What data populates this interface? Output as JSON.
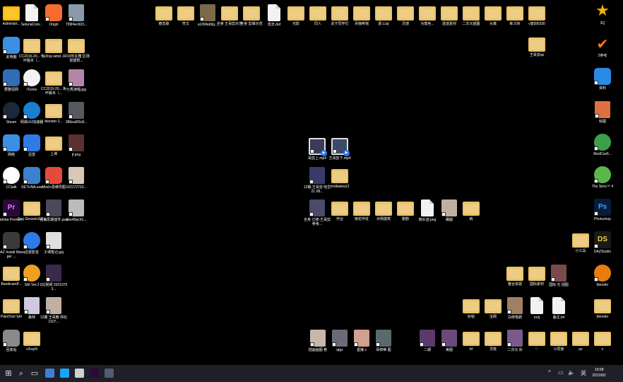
{
  "desktop": {
    "colors": {
      "background": "#000000",
      "taskbar": "#1f1f27",
      "label": "#ffffff",
      "folder": "#e9c26a"
    },
    "icons": {
      "left": [
        {
          "label": "Administr...",
          "kind": "folder-user",
          "color": "#ffb900"
        },
        {
          "label": "SetunaCom...",
          "kind": "doc",
          "color": "#f2f2f2"
        },
        {
          "label": "Origin",
          "kind": "app",
          "color": "#f56c2d"
        },
        {
          "label": "709f4ec603...",
          "kind": "thumb",
          "color": "#8a9aaa"
        },
        {
          "label": "此电脑",
          "kind": "app",
          "color": "#3b90e6"
        },
        {
          "label": "CC2015-20... 免坏版本（...",
          "kind": "folder",
          "color": "#e9c26a"
        },
        {
          "label": "v2ray-wind...",
          "kind": "folder",
          "color": "#e9c26a"
        },
        {
          "label": "6019年在雅 区场景建筑...",
          "kind": "folder",
          "color": "#e9c26a"
        },
        {
          "label": "要雅招网",
          "kind": "app",
          "color": "#2f6db5"
        },
        {
          "label": "iTunes",
          "kind": "round",
          "color": "#f2f2f2"
        },
        {
          "label": "CC2015-20... 免坏版本（...",
          "kind": "folder",
          "color": "#e9c26a"
        },
        {
          "label": "七秀演唱.jpg",
          "kind": "thumb",
          "color": "#b585a8"
        },
        {
          "label": "Steam",
          "kind": "round",
          "color": "#1b2838"
        },
        {
          "label": "网易UU加速器",
          "kind": "round",
          "color": "#1a7fd1"
        },
        {
          "label": "blender-2...",
          "kind": "folder",
          "color": "#e9c26a"
        },
        {
          "label": "386ea5f3c8...",
          "kind": "thumb",
          "color": "#555a60"
        },
        {
          "label": "网络",
          "kind": "app",
          "color": "#3b90e6"
        },
        {
          "label": "迅雷",
          "kind": "app",
          "color": "#2e7ae6"
        },
        {
          "label": "上课",
          "kind": "folder",
          "color": "#e9c26a"
        },
        {
          "label": "jf.png",
          "kind": "thumb",
          "color": "#5a3030"
        },
        {
          "label": "CCtalk",
          "kind": "round",
          "color": "#ffffff"
        },
        {
          "label": "SETUNA.exe",
          "kind": "app",
          "color": "#3c80d0"
        },
        {
          "label": "Mind+思维导图",
          "kind": "app",
          "color": "#e64a3c"
        },
        {
          "label": "162172723...",
          "kind": "thumb",
          "color": "#d8c8b8"
        },
        {
          "label": "Adobe Premie...",
          "kind": "pr",
          "color": "#2a0a3a"
        },
        {
          "label": "Daz Genesis3.2...",
          "kind": "folder",
          "color": "#e9c26a"
        },
        {
          "label": "我偏思期插件.psd",
          "kind": "thumb",
          "color": "#4a4a5a"
        },
        {
          "label": "abe49ac41...",
          "kind": "thumb",
          "color": "#bbbbbb"
        },
        {
          "label": "DAZ Install Manager ...",
          "kind": "app",
          "color": "#3a3a3a"
        },
        {
          "label": "迅雷影音",
          "kind": "round",
          "color": "#2e7ae6"
        },
        {
          "label": "子课笔记.jpg",
          "kind": "thumb",
          "color": "#e0e0e0"
        },
        {
          "label": "BandicamP...",
          "kind": "folder",
          "color": "#e9c26a"
        },
        {
          "label": "SAI Ver.2",
          "kind": "round",
          "color": "#f0a020"
        },
        {
          "label": "QQ视频 20210703...",
          "kind": "thumb",
          "color": "#3a2a4a"
        },
        {
          "label": "PaintTool SAI",
          "kind": "folder",
          "color": "#e9c26a"
        },
        {
          "label": "森林",
          "kind": "thumb",
          "color": "#d0c8e0"
        },
        {
          "label": "12期 王哥教 师社 2107...",
          "kind": "thumb",
          "color": "#c0b0a0"
        },
        {
          "label": "回收站",
          "kind": "app",
          "color": "#8a8a8a"
        },
        {
          "label": "v2rayN",
          "kind": "folder",
          "color": "#e9c26a"
        }
      ],
      "top": [
        {
          "label": "春恋歌",
          "kind": "folder",
          "color": "#e9c26a"
        },
        {
          "label": "符文",
          "kind": "folder",
          "color": "#e9c26a"
        },
        {
          "label": "a10Wab9g...",
          "kind": "thumb",
          "color": "#7a6a4a"
        },
        {
          "label": "全身 王哥剪示范",
          "kind": "folder",
          "color": "#e9c26a"
        },
        {
          "label": "全身 剪辑示范",
          "kind": "folder",
          "color": "#e9c26a"
        },
        {
          "label": "恐无.duf",
          "kind": "doc",
          "color": "#f2f2f2"
        },
        {
          "label": "光影",
          "kind": "folder",
          "color": "#e9c26a"
        },
        {
          "label": "同人",
          "kind": "folder",
          "color": "#e9c26a"
        },
        {
          "label": "关于同学们",
          "kind": "folder",
          "color": "#e9c26a"
        },
        {
          "label": "吊咖啡馆",
          "kind": "folder",
          "color": "#e9c26a"
        },
        {
          "label": "素三sp",
          "kind": "folder",
          "color": "#e9c26a"
        },
        {
          "label": "灵感",
          "kind": "folder",
          "color": "#e9c26a"
        },
        {
          "label": "为角色...",
          "kind": "folder",
          "color": "#e9c26a"
        },
        {
          "label": "透透素材",
          "kind": "folder",
          "color": "#e9c26a"
        },
        {
          "label": "二次元插图",
          "kind": "folder",
          "color": "#e9c26a"
        },
        {
          "label": "头像",
          "kind": "folder",
          "color": "#e9c26a"
        },
        {
          "label": "练习块",
          "kind": "folder",
          "color": "#e9c26a"
        },
        {
          "label": "v富剑0330",
          "kind": "folder",
          "color": "#e9c26a"
        },
        {
          "label": "王哥剪sp",
          "kind": "folder",
          "color": "#e9c26a"
        }
      ],
      "middle": [
        {
          "label": "哥剪上.mp4",
          "kind": "video",
          "color": "#3a3a5a"
        },
        {
          "label": "王哥剪下.mp4",
          "kind": "video",
          "color": "#3a4a6a"
        },
        {
          "label": "12期-王哥剪 哈生 21 08...",
          "kind": "thumb",
          "color": "#3a3a6a"
        },
        {
          "label": "nndlawha12",
          "kind": "folder",
          "color": "#e9c26a"
        },
        {
          "label": "全身 己修-王哥剪 参考...",
          "kind": "thumb",
          "color": "#4a4a6a"
        },
        {
          "label": "作业",
          "kind": "folder",
          "color": "#e9c26a"
        },
        {
          "label": "雨花作仗",
          "kind": "folder",
          "color": "#e9c26a"
        },
        {
          "label": "示例建筑",
          "kind": "folder",
          "color": "#e9c26a"
        },
        {
          "label": "剧剧",
          "kind": "folder",
          "color": "#e9c26a"
        },
        {
          "label": "御头迹.png",
          "kind": "doc",
          "color": "#f2f2f2"
        },
        {
          "label": "绷腿",
          "kind": "thumb",
          "color": "#c0b0a0"
        },
        {
          "label": "纳",
          "kind": "folder",
          "color": "#e9c26a"
        }
      ],
      "bottom": [
        {
          "label": "插画画图 卷",
          "kind": "thumb",
          "color": "#c8b8a8"
        },
        {
          "label": "qtgz",
          "kind": "thumb",
          "color": "#6a6a7a"
        },
        {
          "label": "墨播 z",
          "kind": "thumb",
          "color": "#d0a090"
        },
        {
          "label": "佰修稀 图",
          "kind": "thumb",
          "color": "#5a6a6a"
        },
        {
          "label": "二期",
          "kind": "thumb",
          "color": "#5a3a6a"
        },
        {
          "label": "美图",
          "kind": "thumb",
          "color": "#6a4a7a"
        },
        {
          "label": "bf",
          "kind": "folder",
          "color": "#e9c26a"
        },
        {
          "label": "灵枝",
          "kind": "folder",
          "color": "#e9c26a"
        },
        {
          "label": "二次元 杂",
          "kind": "thumb",
          "color": "#7a5a8a"
        },
        {
          "label": "♡",
          "kind": "folder",
          "color": "#e9c26a"
        },
        {
          "label": "小同家",
          "kind": "folder",
          "color": "#e9c26a"
        },
        {
          "label": "pz",
          "kind": "folder",
          "color": "#e9c26a"
        },
        {
          "label": "z",
          "kind": "folder",
          "color": "#e9c26a"
        }
      ],
      "right_cluster": [
        {
          "label": "小工具",
          "kind": "folder",
          "color": "#e9c26a"
        },
        {
          "label": "整合资源",
          "kind": "folder",
          "color": "#e9c26a"
        },
        {
          "label": "国际素材",
          "kind": "folder",
          "color": "#e9c26a"
        },
        {
          "label": "国际 光 插图",
          "kind": "thumb",
          "color": "#7a4a4a"
        },
        {
          "label": "好柏",
          "kind": "folder",
          "color": "#e9c26a"
        },
        {
          "label": "宝阁",
          "kind": "folder",
          "color": "#e9c26a"
        },
        {
          "label": "白修笔刷",
          "kind": "thumb",
          "color": "#a08060"
        },
        {
          "label": "zzzj",
          "kind": "doc",
          "color": "#f2f2f2"
        },
        {
          "label": "备注.txt",
          "kind": "doc",
          "color": "#f2f2f2"
        }
      ],
      "right": [
        {
          "label": "3Q",
          "kind": "star",
          "color": "#000000"
        },
        {
          "label": "2参考",
          "kind": "check",
          "color": "#000000"
        },
        {
          "label": "资料",
          "kind": "app",
          "color": "#2a8ae6"
        },
        {
          "label": "绘图",
          "kind": "thumb",
          "color": "#e07040"
        },
        {
          "label": "ModConfi...",
          "kind": "round",
          "color": "#3aa04a"
        },
        {
          "label": "The Sims™ 4",
          "kind": "round",
          "color": "#5ab84a"
        },
        {
          "label": "Photoshop",
          "kind": "ps",
          "color": "#0a1a3a"
        },
        {
          "label": "DAZStudio",
          "kind": "ds",
          "color": "#1a1a1a"
        },
        {
          "label": "blender",
          "kind": "round",
          "color": "#e87d0d"
        },
        {
          "label": "blender",
          "kind": "folder",
          "color": "#e9c26a"
        }
      ]
    }
  },
  "taskbar": {
    "start_icon": "windows-logo-icon",
    "search_icon": "search-icon",
    "taskview_icon": "task-view-icon",
    "apps": [
      {
        "name": "explorer-app-icon",
        "color": "#3c7fd6"
      },
      {
        "name": "qq-app-icon",
        "color": "#1aa3ff"
      },
      {
        "name": "paint-app-icon",
        "color": "#d0d0d0"
      },
      {
        "name": "premiere-app-icon",
        "color": "#2a0a3a"
      },
      {
        "name": "settings-app-icon",
        "color": "#555a70"
      }
    ],
    "tray": {
      "chevron": "^",
      "network": "▭",
      "volume": "🔈",
      "ime": "英"
    },
    "clock": {
      "time": "19:58",
      "date": "2021/8/1"
    }
  }
}
